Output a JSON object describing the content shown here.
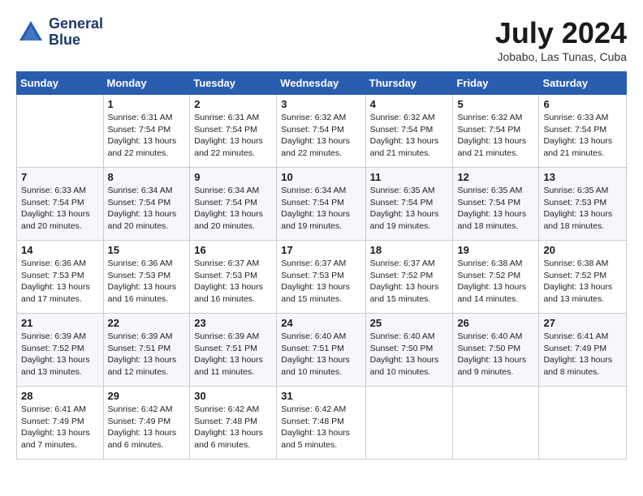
{
  "header": {
    "logo_line1": "General",
    "logo_line2": "Blue",
    "month": "July 2024",
    "location": "Jobabo, Las Tunas, Cuba"
  },
  "days_of_week": [
    "Sunday",
    "Monday",
    "Tuesday",
    "Wednesday",
    "Thursday",
    "Friday",
    "Saturday"
  ],
  "weeks": [
    [
      {
        "day": "",
        "sunrise": "",
        "sunset": "",
        "daylight": ""
      },
      {
        "day": "1",
        "sunrise": "Sunrise: 6:31 AM",
        "sunset": "Sunset: 7:54 PM",
        "daylight": "Daylight: 13 hours and 22 minutes."
      },
      {
        "day": "2",
        "sunrise": "Sunrise: 6:31 AM",
        "sunset": "Sunset: 7:54 PM",
        "daylight": "Daylight: 13 hours and 22 minutes."
      },
      {
        "day": "3",
        "sunrise": "Sunrise: 6:32 AM",
        "sunset": "Sunset: 7:54 PM",
        "daylight": "Daylight: 13 hours and 22 minutes."
      },
      {
        "day": "4",
        "sunrise": "Sunrise: 6:32 AM",
        "sunset": "Sunset: 7:54 PM",
        "daylight": "Daylight: 13 hours and 21 minutes."
      },
      {
        "day": "5",
        "sunrise": "Sunrise: 6:32 AM",
        "sunset": "Sunset: 7:54 PM",
        "daylight": "Daylight: 13 hours and 21 minutes."
      },
      {
        "day": "6",
        "sunrise": "Sunrise: 6:33 AM",
        "sunset": "Sunset: 7:54 PM",
        "daylight": "Daylight: 13 hours and 21 minutes."
      }
    ],
    [
      {
        "day": "7",
        "sunrise": "Sunrise: 6:33 AM",
        "sunset": "Sunset: 7:54 PM",
        "daylight": "Daylight: 13 hours and 20 minutes."
      },
      {
        "day": "8",
        "sunrise": "Sunrise: 6:34 AM",
        "sunset": "Sunset: 7:54 PM",
        "daylight": "Daylight: 13 hours and 20 minutes."
      },
      {
        "day": "9",
        "sunrise": "Sunrise: 6:34 AM",
        "sunset": "Sunset: 7:54 PM",
        "daylight": "Daylight: 13 hours and 20 minutes."
      },
      {
        "day": "10",
        "sunrise": "Sunrise: 6:34 AM",
        "sunset": "Sunset: 7:54 PM",
        "daylight": "Daylight: 13 hours and 19 minutes."
      },
      {
        "day": "11",
        "sunrise": "Sunrise: 6:35 AM",
        "sunset": "Sunset: 7:54 PM",
        "daylight": "Daylight: 13 hours and 19 minutes."
      },
      {
        "day": "12",
        "sunrise": "Sunrise: 6:35 AM",
        "sunset": "Sunset: 7:54 PM",
        "daylight": "Daylight: 13 hours and 18 minutes."
      },
      {
        "day": "13",
        "sunrise": "Sunrise: 6:35 AM",
        "sunset": "Sunset: 7:53 PM",
        "daylight": "Daylight: 13 hours and 18 minutes."
      }
    ],
    [
      {
        "day": "14",
        "sunrise": "Sunrise: 6:36 AM",
        "sunset": "Sunset: 7:53 PM",
        "daylight": "Daylight: 13 hours and 17 minutes."
      },
      {
        "day": "15",
        "sunrise": "Sunrise: 6:36 AM",
        "sunset": "Sunset: 7:53 PM",
        "daylight": "Daylight: 13 hours and 16 minutes."
      },
      {
        "day": "16",
        "sunrise": "Sunrise: 6:37 AM",
        "sunset": "Sunset: 7:53 PM",
        "daylight": "Daylight: 13 hours and 16 minutes."
      },
      {
        "day": "17",
        "sunrise": "Sunrise: 6:37 AM",
        "sunset": "Sunset: 7:53 PM",
        "daylight": "Daylight: 13 hours and 15 minutes."
      },
      {
        "day": "18",
        "sunrise": "Sunrise: 6:37 AM",
        "sunset": "Sunset: 7:52 PM",
        "daylight": "Daylight: 13 hours and 15 minutes."
      },
      {
        "day": "19",
        "sunrise": "Sunrise: 6:38 AM",
        "sunset": "Sunset: 7:52 PM",
        "daylight": "Daylight: 13 hours and 14 minutes."
      },
      {
        "day": "20",
        "sunrise": "Sunrise: 6:38 AM",
        "sunset": "Sunset: 7:52 PM",
        "daylight": "Daylight: 13 hours and 13 minutes."
      }
    ],
    [
      {
        "day": "21",
        "sunrise": "Sunrise: 6:39 AM",
        "sunset": "Sunset: 7:52 PM",
        "daylight": "Daylight: 13 hours and 13 minutes."
      },
      {
        "day": "22",
        "sunrise": "Sunrise: 6:39 AM",
        "sunset": "Sunset: 7:51 PM",
        "daylight": "Daylight: 13 hours and 12 minutes."
      },
      {
        "day": "23",
        "sunrise": "Sunrise: 6:39 AM",
        "sunset": "Sunset: 7:51 PM",
        "daylight": "Daylight: 13 hours and 11 minutes."
      },
      {
        "day": "24",
        "sunrise": "Sunrise: 6:40 AM",
        "sunset": "Sunset: 7:51 PM",
        "daylight": "Daylight: 13 hours and 10 minutes."
      },
      {
        "day": "25",
        "sunrise": "Sunrise: 6:40 AM",
        "sunset": "Sunset: 7:50 PM",
        "daylight": "Daylight: 13 hours and 10 minutes."
      },
      {
        "day": "26",
        "sunrise": "Sunrise: 6:40 AM",
        "sunset": "Sunset: 7:50 PM",
        "daylight": "Daylight: 13 hours and 9 minutes."
      },
      {
        "day": "27",
        "sunrise": "Sunrise: 6:41 AM",
        "sunset": "Sunset: 7:49 PM",
        "daylight": "Daylight: 13 hours and 8 minutes."
      }
    ],
    [
      {
        "day": "28",
        "sunrise": "Sunrise: 6:41 AM",
        "sunset": "Sunset: 7:49 PM",
        "daylight": "Daylight: 13 hours and 7 minutes."
      },
      {
        "day": "29",
        "sunrise": "Sunrise: 6:42 AM",
        "sunset": "Sunset: 7:49 PM",
        "daylight": "Daylight: 13 hours and 6 minutes."
      },
      {
        "day": "30",
        "sunrise": "Sunrise: 6:42 AM",
        "sunset": "Sunset: 7:48 PM",
        "daylight": "Daylight: 13 hours and 6 minutes."
      },
      {
        "day": "31",
        "sunrise": "Sunrise: 6:42 AM",
        "sunset": "Sunset: 7:48 PM",
        "daylight": "Daylight: 13 hours and 5 minutes."
      },
      {
        "day": "",
        "sunrise": "",
        "sunset": "",
        "daylight": ""
      },
      {
        "day": "",
        "sunrise": "",
        "sunset": "",
        "daylight": ""
      },
      {
        "day": "",
        "sunrise": "",
        "sunset": "",
        "daylight": ""
      }
    ]
  ]
}
